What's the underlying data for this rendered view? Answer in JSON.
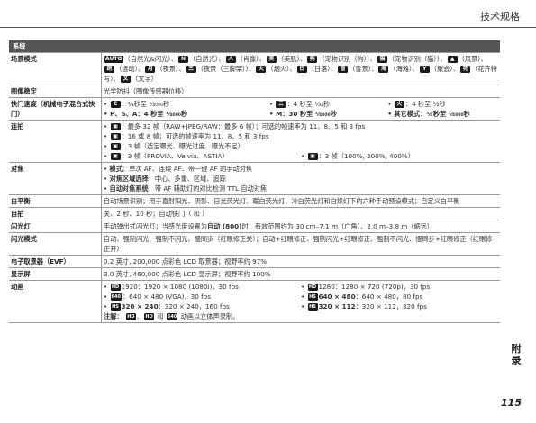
{
  "header": {
    "title": "技术规格"
  },
  "section_title": "系统",
  "rows": {
    "scene": {
      "label": "场景模式",
      "items": [
        {
          "icon": "AUTO",
          "text": "（自然光&amp;闪光）"
        },
        {
          "icon": "N",
          "text": "（自然光）"
        },
        {
          "icon": "人",
          "text": "（肖像）"
        },
        {
          "icon": "美",
          "text": "（美肌）"
        },
        {
          "icon": "狗",
          "text": "（宠物识别（狗））"
        },
        {
          "icon": "猫",
          "text": "（宠物识别（猫））"
        },
        {
          "icon": "▲",
          "text": "（风景）"
        },
        {
          "icon": "跑",
          "text": "（运动）"
        },
        {
          "icon": "月",
          "text": "（夜景）"
        },
        {
          "icon": "三",
          "text": "（夜景（三脚架））"
        },
        {
          "icon": "火",
          "text": "（烟火）"
        },
        {
          "icon": "日",
          "text": "（日落）"
        },
        {
          "icon": "雪",
          "text": "（雪景）"
        },
        {
          "icon": "海",
          "text": "（海滩）"
        },
        {
          "icon": "Y",
          "text": "（聚会）"
        },
        {
          "icon": "花",
          "text": "（花卉特写）"
        },
        {
          "icon": "文",
          "text": "（文字）"
        }
      ],
      "line1": "（自然光&amp;闪光）、（自然光）、（肖像）、（美肌）、（宠物识别（狗））、",
      "line2": "（宠物识别（猫））、（风景）、（运动）、（夜景）、（夜景（三脚架））、（烟火）、",
      "line3": "（日落）、（雪景）、（海滩）、（聚会）、（花卉特写）、（文字）"
    },
    "stab": {
      "label": "图像稳定",
      "value": "光学防抖（图像传感器位移）"
    },
    "shutter": {
      "label": "快门速度（机械电子混合式快门）",
      "a1": "：¼秒至 ¹⁄₄₀₀₀秒",
      "a2": "：4 秒至 ¹⁄₃₂秒",
      "a3": "：4 秒至 ½秒",
      "b1": "P、S、A：4 秒至 ¹⁄₄₀₀₀秒",
      "b2": "M：30 秒至 ¹⁄₄₀₀₀秒",
      "b3": "其它模式：¼秒至 ¹⁄₄₀₀₀秒"
    },
    "burst": {
      "label": "连拍",
      "l1": "：最多 32 帧（RAW+JPEG/RAW：最多 6 帧）；可选的帧速率为 11、8、5 和 3 fps",
      "l2": "：16 或 8 帧；可选的帧速率为 11、8、5 和 3 fps",
      "l3": "：3 帧（选定曝光、曝光过度、曝光不足）",
      "l4a": "：3 帧（PROVIA、Velvia、ASTIA）",
      "l4b": "：3 帧（100%, 200%, 400%）"
    },
    "focus": {
      "label": "对焦",
      "m1b": "模式",
      "m1": "：单次 AF、连续 AF、带一键 AF 的手动对焦",
      "m2b": "对焦区域选择",
      "m2": "：中心、多重、区域、追踪",
      "m3b": "自动对焦系统",
      "m3": "：带 AF 辅助灯的对比检测 TTL 自动对焦"
    },
    "wb": {
      "label": "白平衡",
      "value": "自动场景识别；用于直射阳光、阴影、日光荧光灯、暖白荧光灯、冷白荧光灯和白炽灯下的六种手动预设模式；自定义白平衡"
    },
    "self": {
      "label": "自拍",
      "value": "关、2 秒、10 秒；自动快门（ 和 ）"
    },
    "flash": {
      "label": "闪光灯",
      "v1": "手动弹出式闪光灯；当感光度设置为",
      "vb": "自动 (800)",
      "v2": "时，有效范围约为 30 cm–7.1 m（广角）、2.0 m–3.8 m（缩远）"
    },
    "flashmode": {
      "label": "闪光模式",
      "value": "自动、强制闪光、强制不闪光、慢同步（红眼修正关）；自动+红眼修正、强制闪光+红眼修正、强制不闪光、慢同步+红眼修正（红眼修正开）"
    },
    "evf": {
      "label": "电子取景器（EVF）",
      "value": "0.2 英寸, 200,000 点彩色 LCD 取景器；视野率约 97%"
    },
    "lcd": {
      "label": "显示屏",
      "value": "3.0 英寸, 460,000 点彩色 LCD 显示屏；视野率约 100%"
    },
    "movie": {
      "label": "动画",
      "r1a": "1920：1920 × 1080 (1080i)，30 fps",
      "r1b": "1280：1280 × 720 (720p)，30 fps",
      "r2a": "：640 × 480 (VGA)，30 fps",
      "r2b1": "640 × 480",
      "r2b2": "：640 × 480，80 fps",
      "r3a1": "320 × 240",
      "r3a2": "：320 × 240，160 fps",
      "r3b1": "320 × 112",
      "r3b2": "：320 × 112，320 fps",
      "note_lab": "注解：",
      "note_mid": "和",
      "note_end": "动画以立体声录制。"
    }
  },
  "side_tab": "附录",
  "page_number": "115"
}
